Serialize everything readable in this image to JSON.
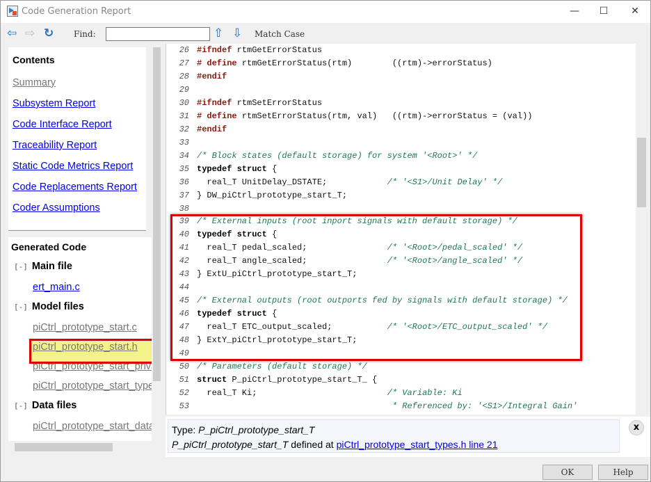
{
  "window": {
    "title": "Code Generation Report",
    "minimize": "—",
    "maximize": "☐",
    "close": "✕"
  },
  "toolbar": {
    "back": "⇦",
    "forward": "⇨",
    "refresh": "↻",
    "find_label": "Find:",
    "find_value": "",
    "prev": "⇧",
    "next": "⇩",
    "match_case": "Match Case"
  },
  "sidebar": {
    "contents_title": "Contents",
    "links": [
      {
        "label": "Summary",
        "visited": true
      },
      {
        "label": "Subsystem Report"
      },
      {
        "label": "Code Interface Report"
      },
      {
        "label": "Traceability Report"
      },
      {
        "label": "Static Code Metrics Report"
      },
      {
        "label": "Code Replacements Report"
      },
      {
        "label": "Coder Assumptions"
      }
    ],
    "generated_title": "Generated Code",
    "toggle": "[-]",
    "groups": [
      {
        "label": "Main file",
        "files": [
          "ert_main.c"
        ]
      },
      {
        "label": "Model files",
        "files": [
          "piCtrl_prototype_start.c",
          "piCtrl_prototype_start.h",
          "piCtrl_prototype_start_private.h",
          "piCtrl_prototype_start_types.h"
        ]
      },
      {
        "label": "Data files",
        "files": [
          "piCtrl_prototype_start_data.c"
        ]
      }
    ],
    "selected_file": "piCtrl_prototype_start.h"
  },
  "code": {
    "lines": [
      {
        "n": "26",
        "s": [
          [
            "kw",
            "#ifndef"
          ],
          [
            "pl",
            " rtmGetErrorStatus"
          ]
        ]
      },
      {
        "n": "27",
        "s": [
          [
            "kw",
            "# define"
          ],
          [
            "pl",
            " rtmGetErrorStatus(rtm)        ((rtm)->errorStatus)"
          ]
        ]
      },
      {
        "n": "28",
        "s": [
          [
            "kw",
            "#endif"
          ]
        ]
      },
      {
        "n": "29",
        "s": []
      },
      {
        "n": "30",
        "s": [
          [
            "kw",
            "#ifndef"
          ],
          [
            "pl",
            " rtmSetErrorStatus"
          ]
        ]
      },
      {
        "n": "31",
        "s": [
          [
            "kw",
            "# define"
          ],
          [
            "pl",
            " rtmSetErrorStatus(rtm, val)   ((rtm)->errorStatus = (val))"
          ]
        ]
      },
      {
        "n": "32",
        "s": [
          [
            "kw",
            "#endif"
          ]
        ]
      },
      {
        "n": "33",
        "s": []
      },
      {
        "n": "34",
        "s": [
          [
            "cm",
            "/* Block states (default storage) for system '<Root>' */"
          ]
        ]
      },
      {
        "n": "35",
        "s": [
          [
            "ty",
            "typedef struct"
          ],
          [
            "pl",
            " {"
          ]
        ]
      },
      {
        "n": "36",
        "s": [
          [
            "pl",
            "  real_T UnitDelay_DSTATE;            "
          ],
          [
            "cm",
            "/* '<S1>/Unit Delay' */"
          ]
        ]
      },
      {
        "n": "37",
        "s": [
          [
            "pl",
            "} DW_piCtrl_prototype_start_T;"
          ]
        ]
      },
      {
        "n": "38",
        "s": []
      },
      {
        "n": "39",
        "s": [
          [
            "cm",
            "/* External inputs (root inport signals with default storage) */"
          ]
        ]
      },
      {
        "n": "40",
        "s": [
          [
            "ty",
            "typedef struct"
          ],
          [
            "pl",
            " {"
          ]
        ]
      },
      {
        "n": "41",
        "s": [
          [
            "pl",
            "  real_T pedal_scaled;                "
          ],
          [
            "cm",
            "/* '<Root>/pedal_scaled' */"
          ]
        ]
      },
      {
        "n": "42",
        "s": [
          [
            "pl",
            "  real_T angle_scaled;                "
          ],
          [
            "cm",
            "/* '<Root>/angle_scaled' */"
          ]
        ]
      },
      {
        "n": "43",
        "s": [
          [
            "pl",
            "} ExtU_piCtrl_prototype_start_T;"
          ]
        ]
      },
      {
        "n": "44",
        "s": []
      },
      {
        "n": "45",
        "s": [
          [
            "cm",
            "/* External outputs (root outports fed by signals with default storage) */"
          ]
        ]
      },
      {
        "n": "46",
        "s": [
          [
            "ty",
            "typedef struct"
          ],
          [
            "pl",
            " {"
          ]
        ]
      },
      {
        "n": "47",
        "s": [
          [
            "pl",
            "  real_T ETC_output_scaled;           "
          ],
          [
            "cm",
            "/* '<Root>/ETC_output_scaled' */"
          ]
        ]
      },
      {
        "n": "48",
        "s": [
          [
            "pl",
            "} ExtY_piCtrl_prototype_start_T;"
          ]
        ]
      },
      {
        "n": "49",
        "s": []
      },
      {
        "n": "50",
        "s": [
          [
            "cm",
            "/* Parameters (default storage) */"
          ]
        ]
      },
      {
        "n": "51",
        "s": [
          [
            "ty",
            "struct"
          ],
          [
            "pl",
            " P_piCtrl_prototype_start_T_ {"
          ]
        ]
      },
      {
        "n": "52",
        "s": [
          [
            "pl",
            "  real_T Ki;                          "
          ],
          [
            "cm",
            "/* Variable: Ki"
          ]
        ]
      },
      {
        "n": "53",
        "s": [
          [
            "pl",
            "                                       "
          ],
          [
            "cm",
            "* Referenced by: '<S1>/Integral Gain'"
          ]
        ]
      }
    ]
  },
  "info": {
    "type_label": "Type: ",
    "type_name": "P_piCtrl_prototype_start_T",
    "def_name": "P_piCtrl_prototype_start_T",
    "def_text": " defined at ",
    "def_link": "piCtrl_prototype_start_types.h line 21",
    "close": "x"
  },
  "buttons": {
    "ok": "OK",
    "help": "Help"
  },
  "colors": {
    "keyword": "#8b1a0f",
    "comment": "#1e7a52",
    "link": "#0000ee",
    "highlight_border": "#e00000",
    "selected_bg": "#f3f38a"
  }
}
